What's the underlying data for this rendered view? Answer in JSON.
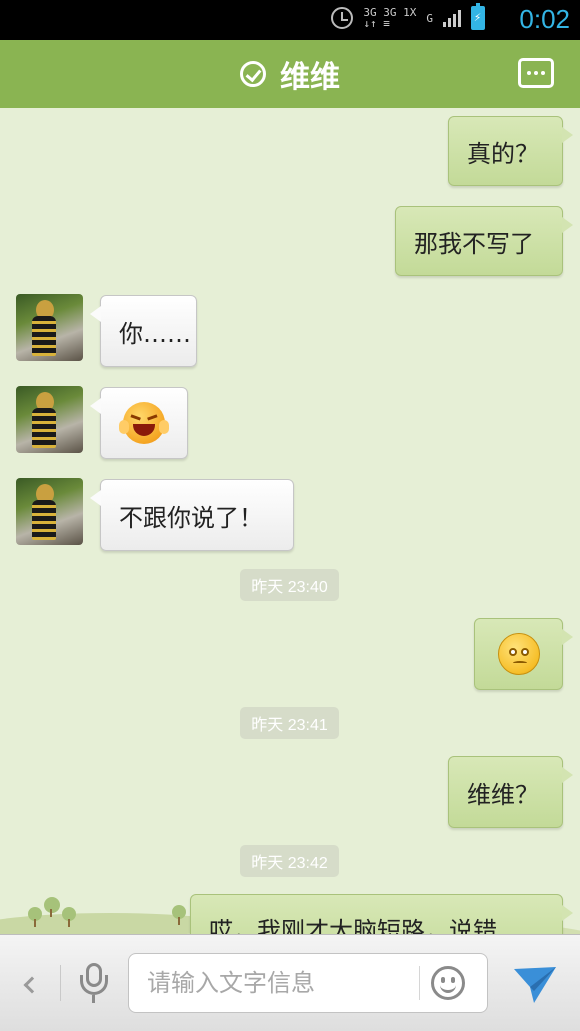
{
  "status_bar": {
    "time": "0:02",
    "network_top": "3G 3G 1X",
    "network_bottom": "↓↑ ≡",
    "signal_label": "G",
    "battery_symbol": "⚡"
  },
  "header": {
    "contact_name": "维维",
    "verified_icon": "check-circle-icon",
    "menu_icon": "more-dots-icon",
    "accent_color": "#8ab452"
  },
  "messages": [
    {
      "direction": "out",
      "type": "text",
      "text": "真的？"
    },
    {
      "direction": "out",
      "type": "text",
      "text": "那我不写了"
    },
    {
      "direction": "in",
      "type": "text",
      "text": "你……"
    },
    {
      "direction": "in",
      "type": "emoji",
      "emoji": "laugh-cover-face-emoji"
    },
    {
      "direction": "in",
      "type": "text",
      "text": "不跟你说了！"
    },
    {
      "type": "timestamp",
      "text": "昨天 23:40"
    },
    {
      "direction": "out",
      "type": "emoji",
      "emoji": "shy-face-emoji"
    },
    {
      "type": "timestamp",
      "text": "昨天 23:41"
    },
    {
      "direction": "out",
      "type": "text",
      "text": "维维？"
    },
    {
      "type": "timestamp",
      "text": "昨天 23:42"
    },
    {
      "direction": "out",
      "type": "text",
      "text": "哎，我刚才大脑短路，说错"
    }
  ],
  "input_bar": {
    "placeholder": "请输入文字信息",
    "value": "",
    "back_icon": "chevron-left-icon",
    "voice_icon": "microphone-icon",
    "emoji_icon": "smiley-icon",
    "send_icon": "send-paper-plane-icon",
    "send_color": "#3a8fd8"
  }
}
